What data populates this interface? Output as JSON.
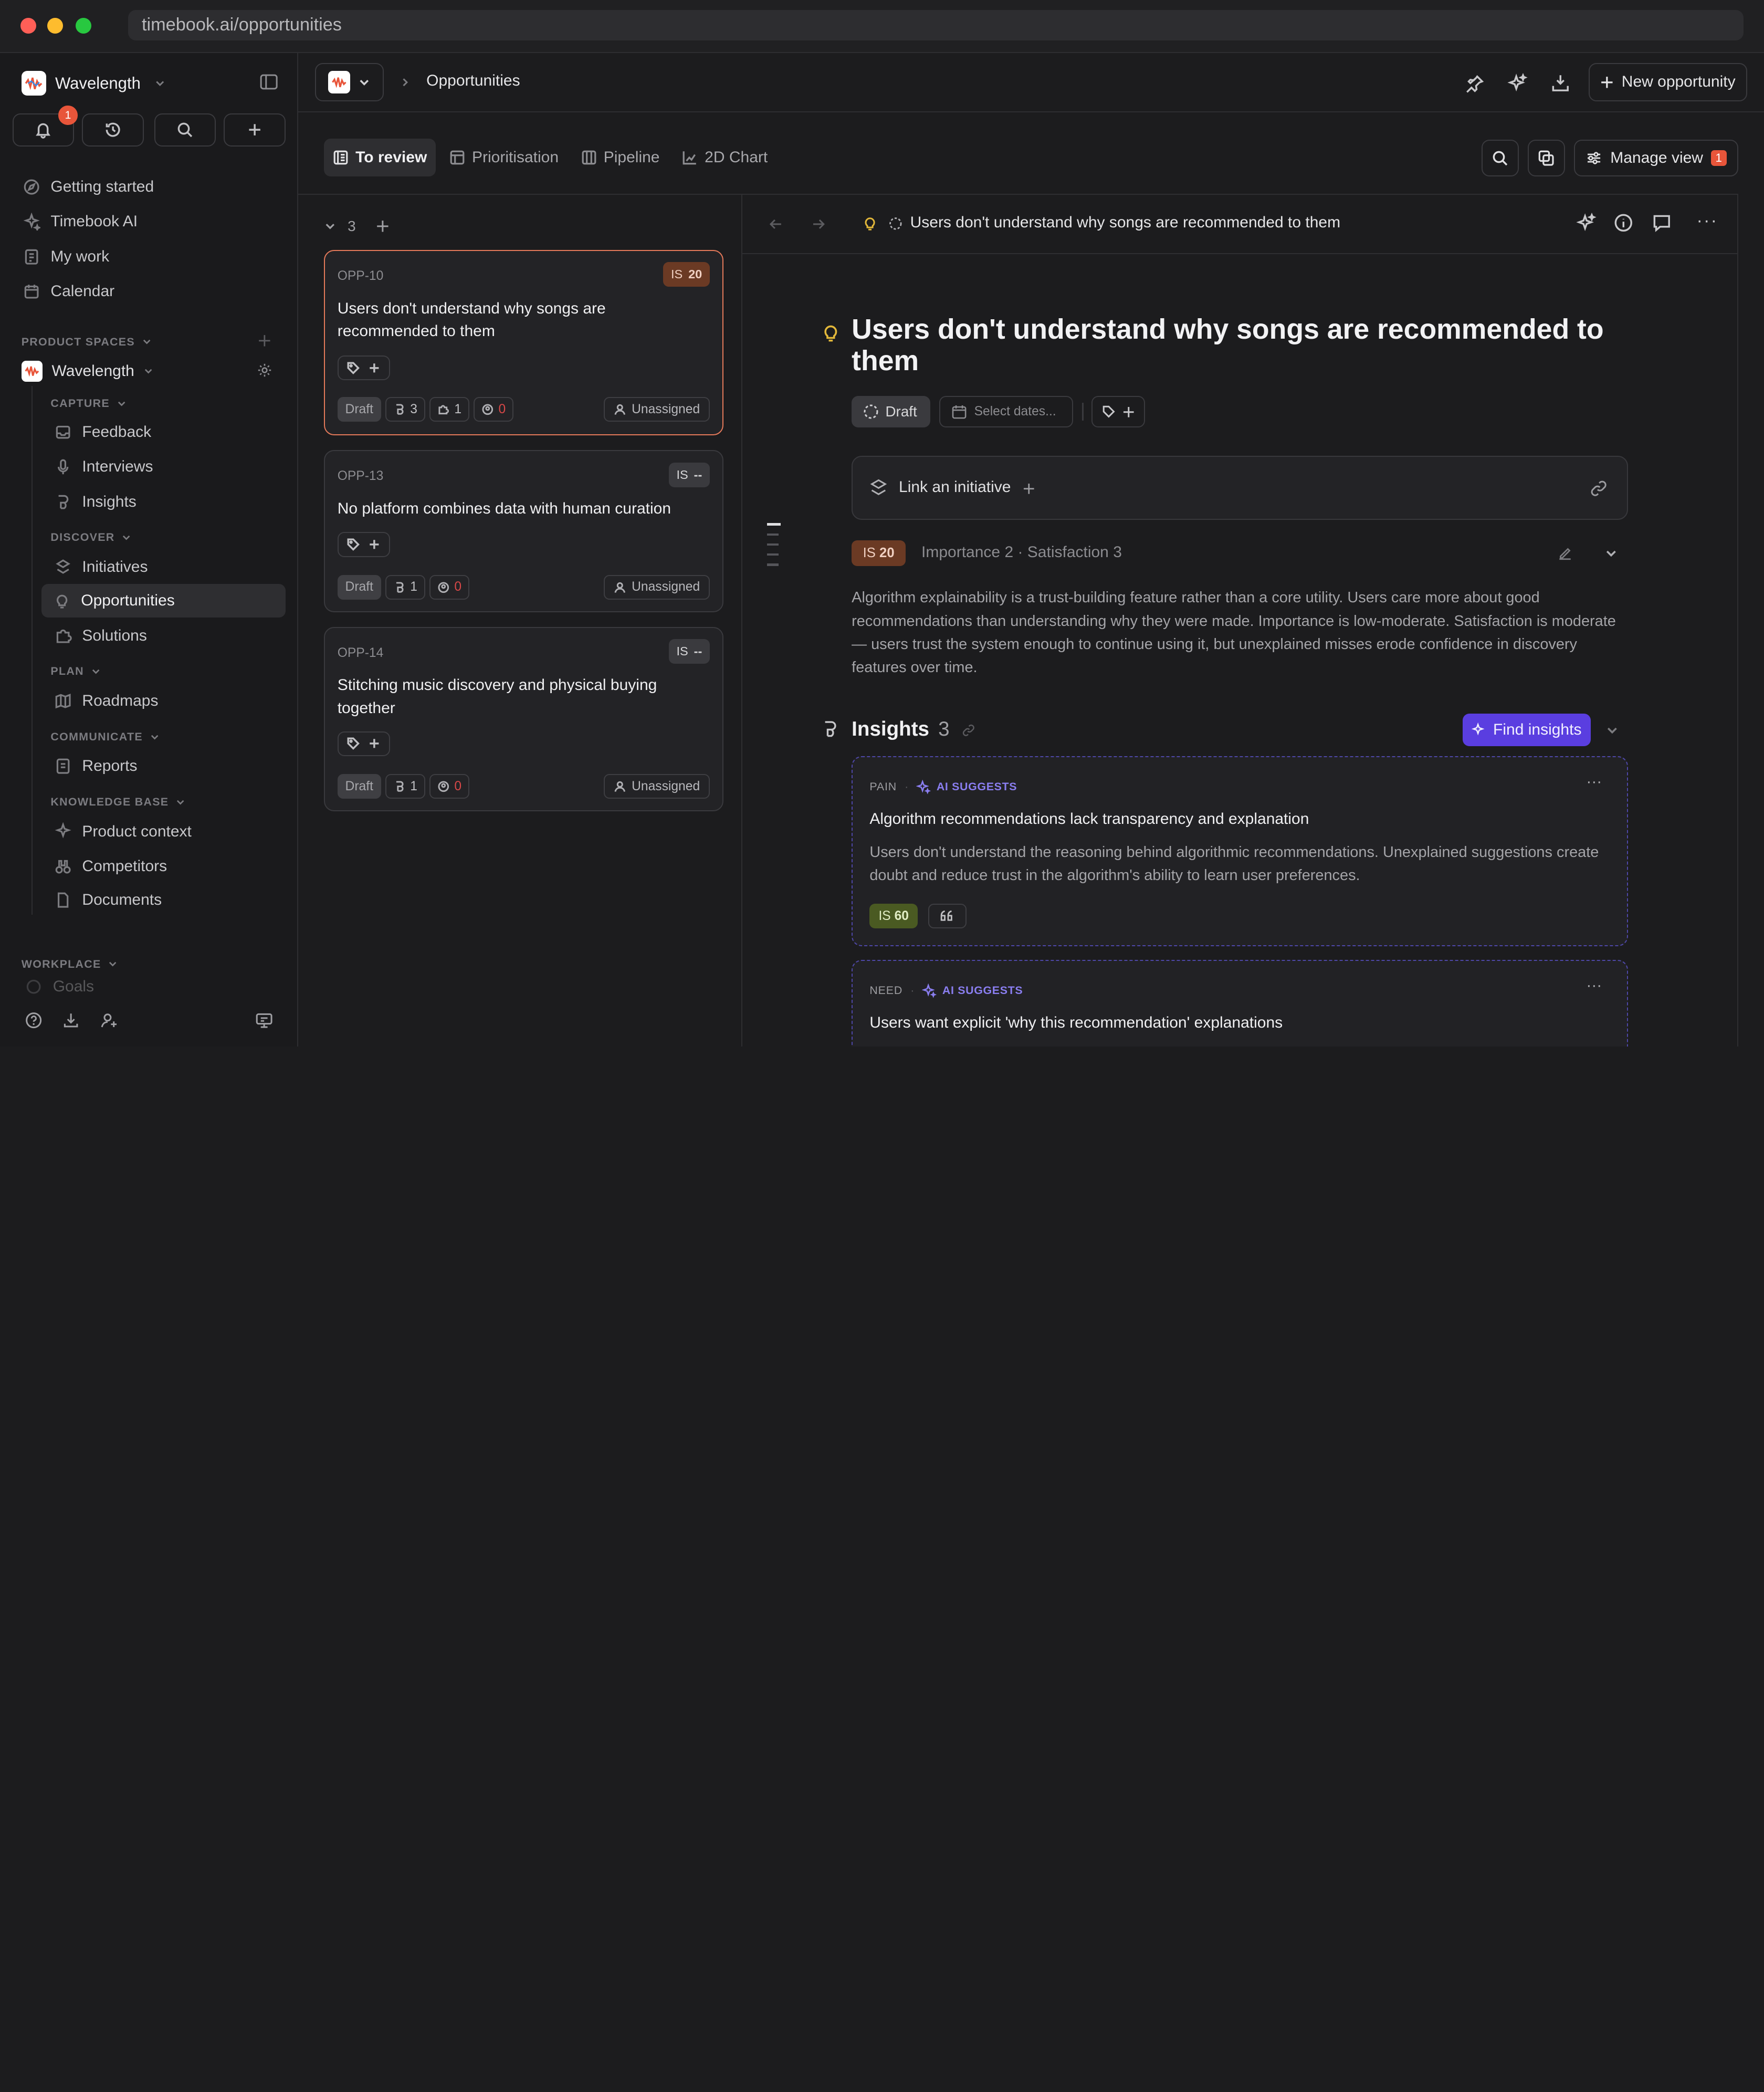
{
  "browser": {
    "url": "timebook.ai/opportunities"
  },
  "colors": {
    "accent": "#5a3ee0",
    "selected_border": "#e4795a",
    "is_orange": "#6b3a24",
    "is_green": "#4a5a22",
    "notif": "#e8553a"
  },
  "sidebar": {
    "workspace": "Wavelength",
    "notifications_count": "1",
    "top_items": [
      {
        "label": "Getting started",
        "icon": "compass-icon"
      },
      {
        "label": "Timebook AI",
        "icon": "sparkle-icon"
      },
      {
        "label": "My work",
        "icon": "clipboard-icon"
      },
      {
        "label": "Calendar",
        "icon": "calendar-icon"
      }
    ],
    "product_spaces_label": "PRODUCT SPACES",
    "space_name": "Wavelength",
    "capture_label": "CAPTURE",
    "capture_items": [
      "Feedback",
      "Interviews",
      "Insights"
    ],
    "discover_label": "DISCOVER",
    "discover_items": [
      "Initiatives",
      "Opportunities",
      "Solutions"
    ],
    "plan_label": "PLAN",
    "plan_items": [
      "Roadmaps"
    ],
    "communicate_label": "COMMUNICATE",
    "communicate_items": [
      "Reports"
    ],
    "kb_label": "KNOWLEDGE BASE",
    "kb_items": [
      "Product context",
      "Competitors",
      "Documents"
    ],
    "workplace_label": "WORKPLACE",
    "cut_item": "Goals"
  },
  "topbar": {
    "breadcrumb": "Opportunities",
    "new_button": "New opportunity"
  },
  "tabs": [
    {
      "label": "To review"
    },
    {
      "label": "Prioritisation"
    },
    {
      "label": "Pipeline"
    },
    {
      "label": "2D Chart"
    }
  ],
  "manage_view": {
    "label": "Manage view",
    "count": "1"
  },
  "list": {
    "group_count": "3",
    "cards": [
      {
        "id": "OPP-10",
        "is_label": "IS",
        "is_value": "20",
        "title": "Users don't understand why songs are recommended to them",
        "status": "Draft",
        "insights": "3",
        "solutions": "1",
        "votes": "0",
        "assignee": "Unassigned"
      },
      {
        "id": "OPP-13",
        "is_label": "IS",
        "is_value": "--",
        "title": "No platform combines data with human curation",
        "status": "Draft",
        "insights": "1",
        "votes": "0",
        "assignee": "Unassigned"
      },
      {
        "id": "OPP-14",
        "is_label": "IS",
        "is_value": "--",
        "title": "Stitching music discovery and physical buying together",
        "status": "Draft",
        "insights": "1",
        "votes": "0",
        "assignee": "Unassigned"
      }
    ]
  },
  "detail": {
    "header_title": "Users don't understand why songs are recommended to them",
    "title": "Users don't understand why songs are recommended to them",
    "status": "Draft",
    "dates_placeholder": "Select dates...",
    "link_initiative": "Link an initiative",
    "is_label": "IS",
    "is_value": "20",
    "importance_text": "Importance 2 · Satisfaction 3",
    "description": "Algorithm explainability is a trust-building feature rather than a core utility. Users care more about good recommendations than understanding why they were made. Importance is low-moderate. Satisfaction is moderate — users trust the system enough to continue using it, but unexplained misses erode confidence in discovery features over time.",
    "insights_heading": "Insights",
    "insights_count": "3",
    "find_insights": "Find insights",
    "insights": [
      {
        "type": "PAIN",
        "ai": "AI SUGGESTS",
        "title": "Algorithm recommendations lack transparency and explanation",
        "body": "Users don't understand the reasoning behind algorithmic recommendations. Unexplained suggestions create doubt and reduce trust in the algorithm's ability to learn user preferences.",
        "is_label": "IS",
        "is_value": "60"
      },
      {
        "type": "NEED",
        "ai": "AI SUGGESTS",
        "title": "Users want explicit 'why this recommendation' explanations"
      }
    ]
  }
}
